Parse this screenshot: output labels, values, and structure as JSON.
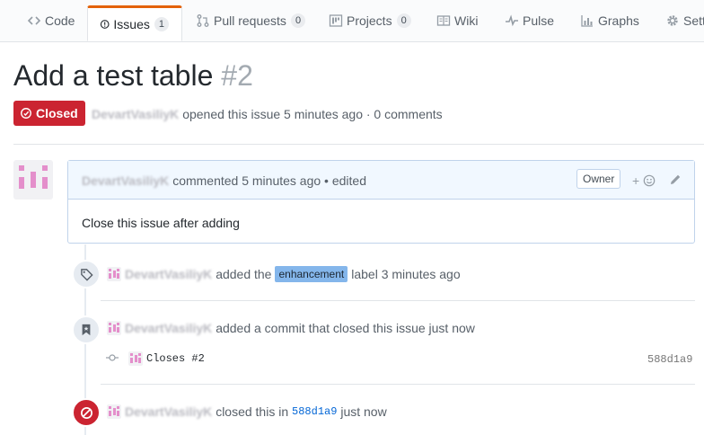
{
  "tabs": [
    {
      "label": "Code",
      "icon": "code-icon"
    },
    {
      "label": "Issues",
      "icon": "issue-icon",
      "count": "1",
      "selected": true
    },
    {
      "label": "Pull requests",
      "icon": "pull-request-icon",
      "count": "0"
    },
    {
      "label": "Projects",
      "icon": "project-icon",
      "count": "0"
    },
    {
      "label": "Wiki",
      "icon": "book-icon"
    },
    {
      "label": "Pulse",
      "icon": "pulse-icon"
    },
    {
      "label": "Graphs",
      "icon": "graph-icon"
    },
    {
      "label": "Sett",
      "icon": "gear-icon"
    }
  ],
  "issue": {
    "title": "Add a test table",
    "number": "#2",
    "state": "Closed",
    "author": "DevartVasiliyK",
    "meta": "opened this issue 5 minutes ago · 0 comments"
  },
  "comment": {
    "author": "DevartVasiliyK",
    "header": "commented 5 minutes ago • edited",
    "role": "Owner",
    "reaction": "+",
    "body": "Close this issue after adding"
  },
  "timeline": {
    "label_event": {
      "actor": "DevartVasiliyK",
      "pre": "added the",
      "label": "enhancement",
      "post": "label 3 minutes ago"
    },
    "commit_event": {
      "actor": "DevartVasiliyK",
      "text": "added a commit that closed this issue just now",
      "message": "Closes #2",
      "sha": "588d1a9"
    },
    "close_event": {
      "actor": "DevartVasiliyK",
      "pre": "closed this in",
      "sha": "588d1a9",
      "post": "just now"
    }
  },
  "colors": {
    "closed": "#cb2431",
    "label": "#84b6eb",
    "tab_accent": "#e36209"
  }
}
